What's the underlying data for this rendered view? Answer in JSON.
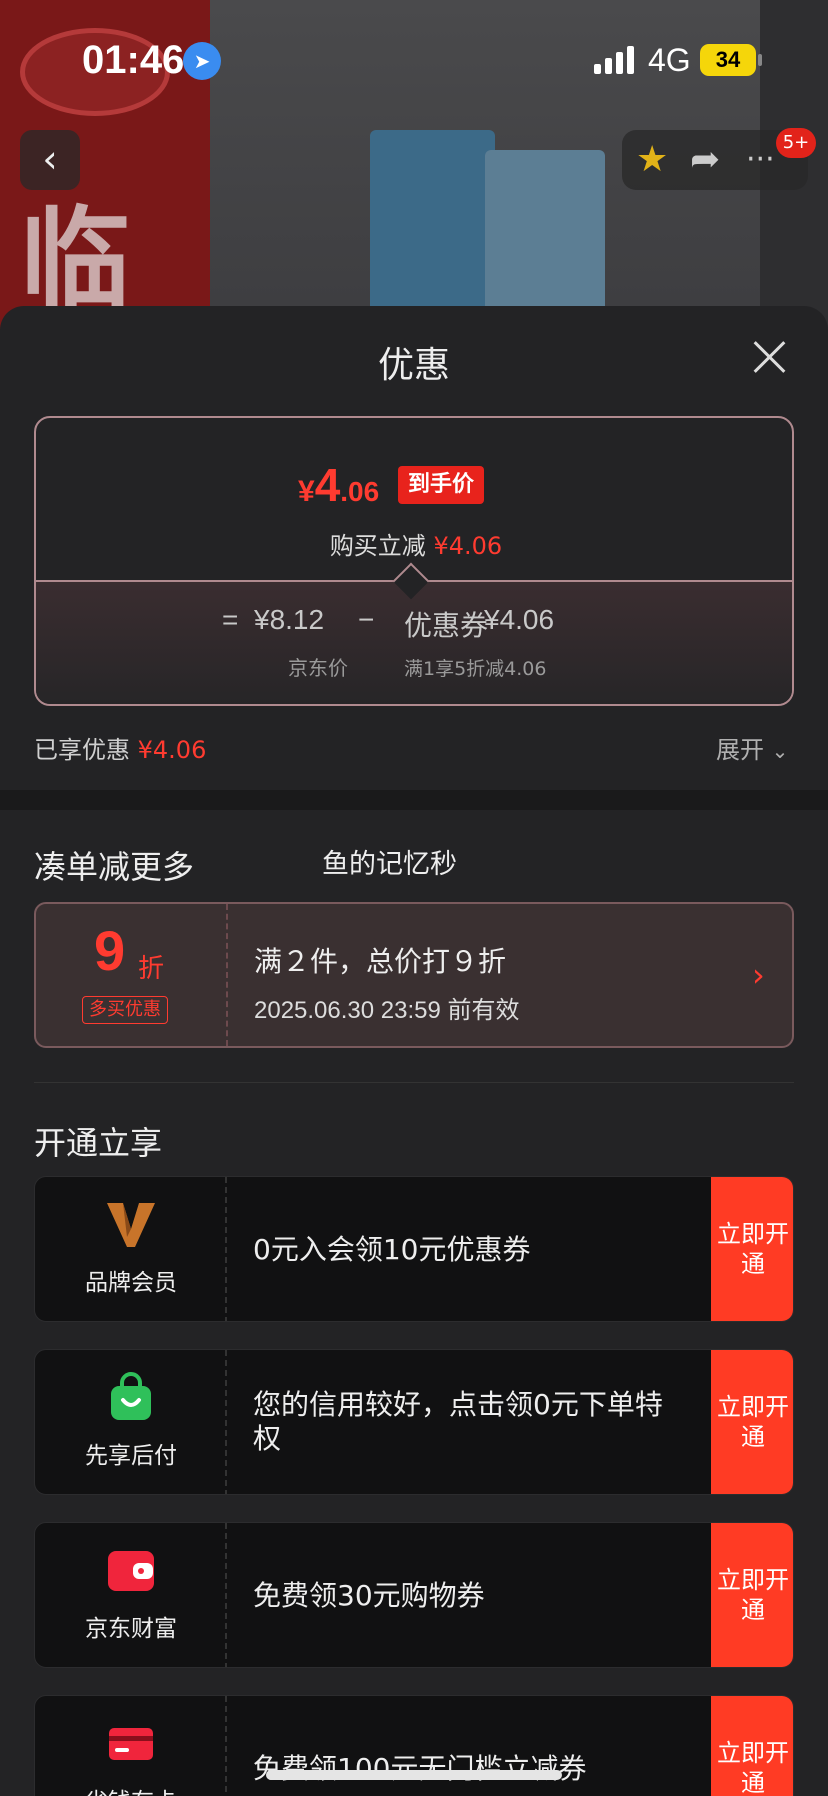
{
  "status_bar": {
    "time": "01:46",
    "network": "4G",
    "battery": "34"
  },
  "nav": {
    "badge": "5+"
  },
  "sheet": {
    "title": "优惠",
    "price_card": {
      "currency": "¥",
      "final_int": "4",
      "final_dec": ".06",
      "final_tag": "到手价",
      "instant_label": "购买立减",
      "instant_amount": "¥4.06",
      "eq": "=",
      "jd_price": "¥8.12",
      "minus": "−",
      "coupon_label": "优惠券",
      "coupon_amount": "¥4.06",
      "jd_price_label": "京东价",
      "coupon_desc": "满1享5折减4.06"
    },
    "enjoyed_label": "已享优惠",
    "enjoyed_amount": "¥4.06",
    "expand_label": "展开"
  },
  "combo": {
    "section_title": "凑单减更多",
    "username": "鱼的记忆秒",
    "discount_num": "9",
    "discount_unit": "折",
    "discount_tag": "多买优惠",
    "main": "满２件，总价打９折",
    "valid": "2025.06.30 23:59 前有效"
  },
  "perks": {
    "section_title": "开通立享",
    "items": [
      {
        "label": "品牌会员",
        "text": "0元入会领10元优惠券",
        "button": "立即开通",
        "icon": "brand-v-icon"
      },
      {
        "label": "先享后付",
        "text": "您的信用较好，点击领0元下单特权",
        "button": "立即开通",
        "icon": "shopping-bag-icon"
      },
      {
        "label": "京东财富",
        "text": "免费领30元购物券",
        "button": "立即开通",
        "icon": "wallet-icon"
      },
      {
        "label": "省钱有卡",
        "text": "免费领100元无门槛立减券",
        "button": "立即开通",
        "icon": "card-icon"
      }
    ]
  },
  "colors": {
    "accent": "#ff3b30",
    "button_bg": "#ff3b24",
    "bg": "#232325"
  }
}
